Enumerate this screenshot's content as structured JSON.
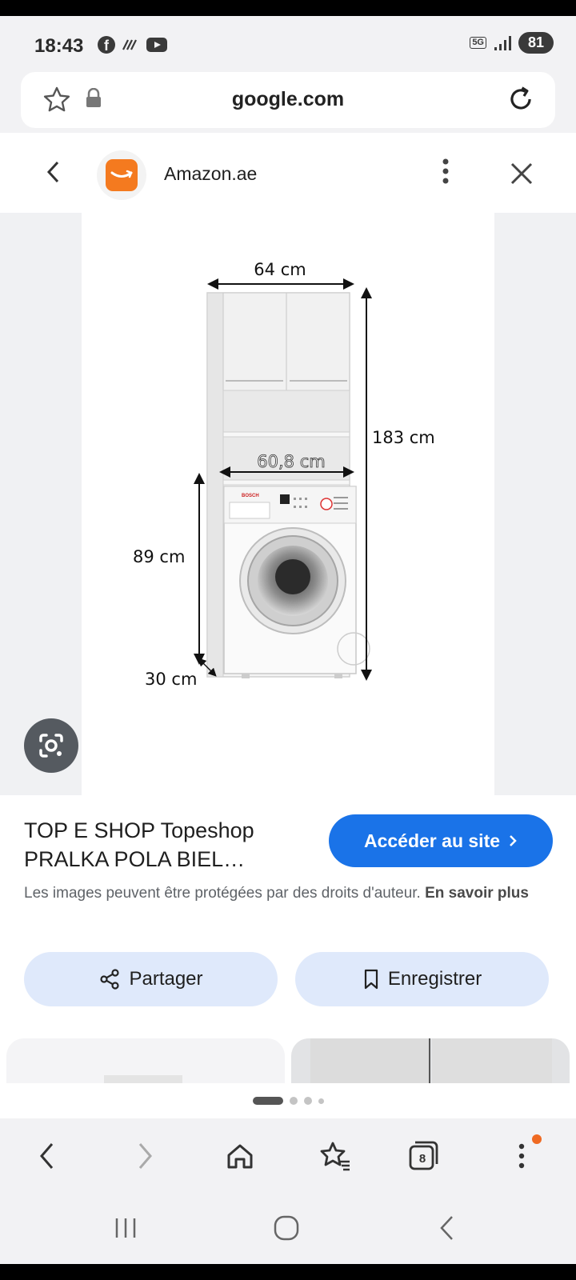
{
  "status_bar": {
    "time": "18:43",
    "network": "5G",
    "battery": "81"
  },
  "address_bar": {
    "url": "google.com"
  },
  "source": {
    "name": "Amazon.ae"
  },
  "image": {
    "dimensions": {
      "width_top": "64 cm",
      "height_total": "183 cm",
      "inner_width": "60,8 cm",
      "lower_height": "89 cm",
      "depth": "30 cm"
    },
    "washer_brand": "BOSCH"
  },
  "product": {
    "title_line1": "TOP E SHOP Topeshop",
    "title_line2": "PRALKA POLA BIEL…",
    "visit_button": "Accéder au site",
    "copyright_text": "Les images peuvent être protégées par des droits d'auteur.",
    "learn_more": "En savoir plus",
    "share_label": "Partager",
    "save_label": "Enregistrer"
  },
  "toolbar": {
    "tabs_count": "8"
  },
  "colors": {
    "accent_blue": "#1a73e8",
    "amazon_orange": "#f47a1f",
    "pill_bg": "#dfe9fb"
  }
}
